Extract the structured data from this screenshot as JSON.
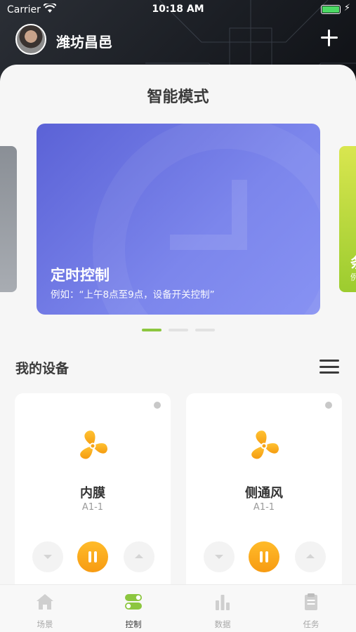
{
  "status_bar": {
    "carrier": "Carrier",
    "time": "10:18 AM"
  },
  "header": {
    "location": "潍坊昌邑",
    "add_icon": "plus-icon"
  },
  "section_smart": {
    "title": "智能模式"
  },
  "smart_modes": {
    "active_card": {
      "title": "定时控制",
      "subtitle": "例如：“上午8点至9点，设备开关控制”"
    },
    "next_card_peek": {
      "title": "条",
      "subtitle": "例"
    },
    "pager": {
      "count": 3,
      "active_index": 0
    }
  },
  "my_devices": {
    "title": "我的设备",
    "menu_icon": "list-icon"
  },
  "devices": [
    {
      "name": "内膜",
      "code": "A1-1",
      "icon": "fan-icon"
    },
    {
      "name": "侧通风",
      "code": "A1-1",
      "icon": "fan-icon"
    }
  ],
  "tabbar": {
    "items": [
      {
        "label": "场景",
        "icon": "home-icon",
        "active": false
      },
      {
        "label": "控制",
        "icon": "toggle-icon",
        "active": true
      },
      {
        "label": "数据",
        "icon": "bar-chart-icon",
        "active": false
      },
      {
        "label": "任务",
        "icon": "clipboard-icon",
        "active": false
      }
    ]
  },
  "colors": {
    "accent_green": "#8cc63f",
    "card_blue": "#6b74e3",
    "fan_orange": "#f9a91b"
  }
}
